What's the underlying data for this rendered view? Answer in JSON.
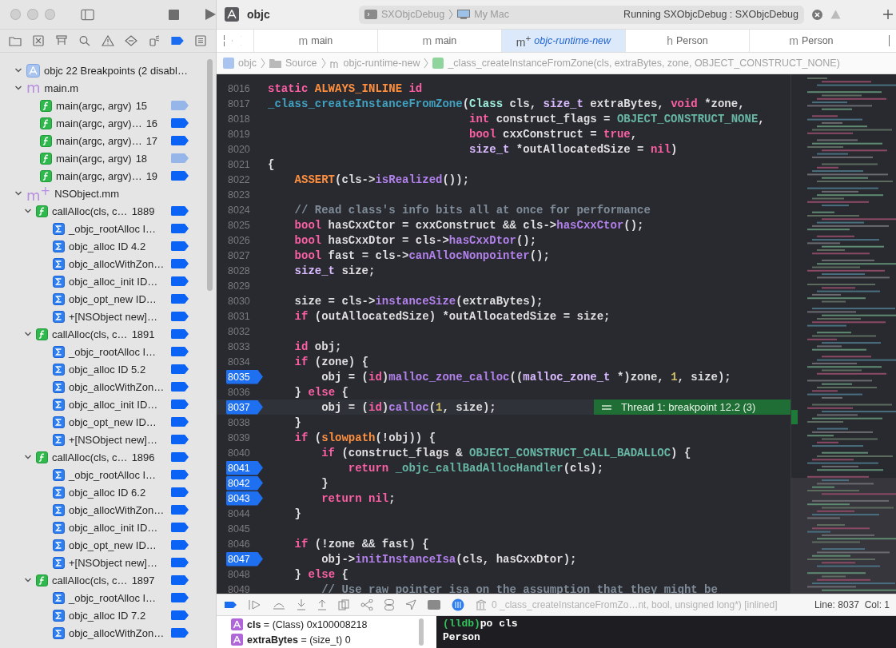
{
  "toolbar": {
    "project": "objc",
    "scheme": "SXObjcDebug",
    "destination": "My Mac",
    "status": "Running SXObjcDebug : SXObjcDebug"
  },
  "navigator": {
    "icons": [
      {
        "kind": "folder",
        "selected": false
      },
      {
        "kind": "xbox",
        "selected": false
      },
      {
        "kind": "hierarchy",
        "selected": false
      },
      {
        "kind": "search",
        "selected": false
      },
      {
        "kind": "warning",
        "selected": false
      },
      {
        "kind": "diamond",
        "selected": false
      },
      {
        "kind": "spray",
        "selected": false
      },
      {
        "kind": "breakpoint",
        "selected": true
      },
      {
        "kind": "report",
        "selected": false
      }
    ]
  },
  "breakpoints": {
    "root": {
      "label": "objc 22 Breakpoints (2 disabl…",
      "expanded": true
    },
    "files": [
      {
        "name": "main.m",
        "letter": "m",
        "expanded": true,
        "items": [
          {
            "kind": "function",
            "label": "main(argc, argv)",
            "line": "15",
            "enabled": false
          },
          {
            "kind": "function",
            "label": "main(argc, argv)…",
            "line": "16",
            "enabled": true
          },
          {
            "kind": "function",
            "label": "main(argc, argv)…",
            "line": "17",
            "enabled": true
          },
          {
            "kind": "function",
            "label": "main(argc, argv)",
            "line": "18",
            "enabled": false
          },
          {
            "kind": "function",
            "label": "main(argc, argv)…",
            "line": "19",
            "enabled": true
          }
        ]
      },
      {
        "name": "NSObject.mm",
        "letter": "m$^{+}$",
        "expanded": true,
        "items": [
          {
            "kind": "function",
            "label": "callAlloc(cls, c…",
            "line": "1889",
            "enabled": true,
            "expanded": true,
            "children": [
              {
                "kind": "symbol",
                "label": "_objc_rootAlloc  I…",
                "enabled": true
              },
              {
                "kind": "symbol",
                "label": "objc_alloc  ID 4.2",
                "enabled": true
              },
              {
                "kind": "symbol",
                "label": "objc_allocWithZon…",
                "enabled": true
              },
              {
                "kind": "symbol",
                "label": "objc_alloc_init  ID…",
                "enabled": true
              },
              {
                "kind": "symbol",
                "label": "objc_opt_new  ID…",
                "enabled": true
              },
              {
                "kind": "symbol",
                "label": "+[NSObject new]…",
                "enabled": true
              }
            ]
          },
          {
            "kind": "function",
            "label": "callAlloc(cls, c…",
            "line": "1891",
            "enabled": true,
            "expanded": true,
            "children": [
              {
                "kind": "symbol",
                "label": "_objc_rootAlloc  I…",
                "enabled": true
              },
              {
                "kind": "symbol",
                "label": "objc_alloc  ID 5.2",
                "enabled": true
              },
              {
                "kind": "symbol",
                "label": "objc_allocWithZon…",
                "enabled": true
              },
              {
                "kind": "symbol",
                "label": "objc_alloc_init  ID…",
                "enabled": true
              },
              {
                "kind": "symbol",
                "label": "objc_opt_new  ID…",
                "enabled": true
              },
              {
                "kind": "symbol",
                "label": "+[NSObject new]…",
                "enabled": true
              }
            ]
          },
          {
            "kind": "function",
            "label": "callAlloc(cls, c…",
            "line": "1896",
            "enabled": true,
            "expanded": true,
            "children": [
              {
                "kind": "symbol",
                "label": "_objc_rootAlloc  I…",
                "enabled": true
              },
              {
                "kind": "symbol",
                "label": "objc_alloc  ID 6.2",
                "enabled": true
              },
              {
                "kind": "symbol",
                "label": "objc_allocWithZon…",
                "enabled": true
              },
              {
                "kind": "symbol",
                "label": "objc_alloc_init  ID…",
                "enabled": true
              },
              {
                "kind": "symbol",
                "label": "objc_opt_new  ID…",
                "enabled": true
              },
              {
                "kind": "symbol",
                "label": "+[NSObject new]…",
                "enabled": true
              }
            ]
          },
          {
            "kind": "function",
            "label": "callAlloc(cls, c…",
            "line": "1897",
            "enabled": true,
            "expanded": true,
            "children": [
              {
                "kind": "symbol",
                "label": "_objc_rootAlloc  I…",
                "enabled": true
              },
              {
                "kind": "symbol",
                "label": "objc_alloc  ID 7.2",
                "enabled": true
              },
              {
                "kind": "symbol",
                "label": "objc_allocWithZon…",
                "enabled": true
              }
            ]
          }
        ]
      }
    ]
  },
  "tabs": [
    {
      "letter": "m",
      "label": "main",
      "selected": false
    },
    {
      "letter": "m",
      "label": "main",
      "selected": false
    },
    {
      "letter": "m$^{+}$",
      "label": "objc-runtime-new",
      "selected": true
    },
    {
      "letter": "h",
      "label": "Person",
      "selected": false
    },
    {
      "letter": "m",
      "label": "Person",
      "selected": false
    }
  ],
  "jump_bar": [
    "objc",
    "Source",
    "objc-runtime-new",
    "_class_createInstanceFromZone(cls, extraBytes, zone, OBJECT_CONSTRUCT_NONE)"
  ],
  "code": {
    "annotation": "Thread 1: breakpoint 12.2 (3)",
    "lines": [
      {
        "number": "8016",
        "breakpoint": false,
        "current": false,
        "tokens": [
          {
            "kind": "k",
            "text": "static "
          },
          {
            "kind": "m",
            "text": "ALWAYS_INLINE "
          },
          {
            "kind": "k",
            "text": "id"
          }
        ]
      },
      {
        "number": "8017",
        "breakpoint": false,
        "current": false,
        "tokens": [
          {
            "kind": "d",
            "text": "_class_createInstanceFromZone"
          },
          {
            "kind": "x",
            "text": "("
          },
          {
            "kind": "c",
            "text": "Class"
          },
          {
            "kind": "x",
            "text": " cls, "
          },
          {
            "kind": "t",
            "text": "size_t"
          },
          {
            "kind": "x",
            "text": " extraBytes, "
          },
          {
            "kind": "k",
            "text": "void"
          },
          {
            "kind": "x",
            "text": " *zone,"
          }
        ]
      },
      {
        "number": "8018",
        "breakpoint": false,
        "current": false,
        "tokens": [
          {
            "kind": "k",
            "text": "                              int"
          },
          {
            "kind": "x",
            "text": " construct_flags = "
          },
          {
            "kind": "p",
            "text": "OBJECT_CONSTRUCT_NONE"
          },
          {
            "kind": "x",
            "text": ","
          }
        ]
      },
      {
        "number": "8019",
        "breakpoint": false,
        "current": false,
        "tokens": [
          {
            "kind": "k",
            "text": "                              bool"
          },
          {
            "kind": "x",
            "text": " cxxConstruct = "
          },
          {
            "kind": "k",
            "text": "true"
          },
          {
            "kind": "x",
            "text": ","
          }
        ]
      },
      {
        "number": "8020",
        "breakpoint": false,
        "current": false,
        "tokens": [
          {
            "kind": "t",
            "text": "                              size_t"
          },
          {
            "kind": "x",
            "text": " *outAllocatedSize = "
          },
          {
            "kind": "k",
            "text": "nil"
          },
          {
            "kind": "x",
            "text": ")"
          }
        ]
      },
      {
        "number": "8021",
        "breakpoint": false,
        "current": false,
        "tokens": [
          {
            "kind": "x",
            "text": "{"
          }
        ]
      },
      {
        "number": "8022",
        "breakpoint": false,
        "current": false,
        "tokens": [
          {
            "kind": "m",
            "text": "    ASSERT"
          },
          {
            "kind": "x",
            "text": "(cls->"
          },
          {
            "kind": "f",
            "text": "isRealized"
          },
          {
            "kind": "x",
            "text": "());"
          }
        ]
      },
      {
        "number": "8023",
        "breakpoint": false,
        "current": false
      },
      {
        "number": "8024",
        "breakpoint": false,
        "current": false,
        "tokens": [
          {
            "kind": "cm",
            "text": "    // Read class's info bits all at once for performance"
          }
        ]
      },
      {
        "number": "8025",
        "breakpoint": false,
        "current": false,
        "tokens": [
          {
            "kind": "k",
            "text": "    bool"
          },
          {
            "kind": "x",
            "text": " hasCxxCtor = cxxConstruct && cls->"
          },
          {
            "kind": "f",
            "text": "hasCxxCtor"
          },
          {
            "kind": "x",
            "text": "();"
          }
        ]
      },
      {
        "number": "8026",
        "breakpoint": false,
        "current": false,
        "tokens": [
          {
            "kind": "k",
            "text": "    bool"
          },
          {
            "kind": "x",
            "text": " hasCxxDtor = cls->"
          },
          {
            "kind": "f",
            "text": "hasCxxDtor"
          },
          {
            "kind": "x",
            "text": "();"
          }
        ]
      },
      {
        "number": "8027",
        "breakpoint": false,
        "current": false,
        "tokens": [
          {
            "kind": "k",
            "text": "    bool"
          },
          {
            "kind": "x",
            "text": " fast = cls->"
          },
          {
            "kind": "f",
            "text": "canAllocNonpointer"
          },
          {
            "kind": "x",
            "text": "();"
          }
        ]
      },
      {
        "number": "8028",
        "breakpoint": false,
        "current": false,
        "tokens": [
          {
            "kind": "t",
            "text": "    size_t"
          },
          {
            "kind": "x",
            "text": " size;"
          }
        ]
      },
      {
        "number": "8029",
        "breakpoint": false,
        "current": false
      },
      {
        "number": "8030",
        "breakpoint": false,
        "current": false,
        "tokens": [
          {
            "kind": "x",
            "text": "    size = cls->"
          },
          {
            "kind": "f",
            "text": "instanceSize"
          },
          {
            "kind": "x",
            "text": "(extraBytes);"
          }
        ]
      },
      {
        "number": "8031",
        "breakpoint": false,
        "current": false,
        "tokens": [
          {
            "kind": "k",
            "text": "    if"
          },
          {
            "kind": "x",
            "text": " (outAllocatedSize) *outAllocatedSize = size;"
          }
        ]
      },
      {
        "number": "8032",
        "breakpoint": false,
        "current": false
      },
      {
        "number": "8033",
        "breakpoint": false,
        "current": false,
        "tokens": [
          {
            "kind": "k",
            "text": "    id"
          },
          {
            "kind": "x",
            "text": " obj;"
          }
        ]
      },
      {
        "number": "8034",
        "breakpoint": false,
        "current": false,
        "tokens": [
          {
            "kind": "k",
            "text": "    if"
          },
          {
            "kind": "x",
            "text": " (zone) {"
          }
        ]
      },
      {
        "number": "8035",
        "breakpoint": true,
        "current": false,
        "tokens": [
          {
            "kind": "x",
            "text": "        obj = ("
          },
          {
            "kind": "k",
            "text": "id"
          },
          {
            "kind": "x",
            "text": ")"
          },
          {
            "kind": "f",
            "text": "malloc_zone_calloc"
          },
          {
            "kind": "x",
            "text": "(("
          },
          {
            "kind": "t",
            "text": "malloc_zone_t"
          },
          {
            "kind": "x",
            "text": " *)zone, "
          },
          {
            "kind": "n",
            "text": "1"
          },
          {
            "kind": "x",
            "text": ", size);"
          }
        ]
      },
      {
        "number": "8036",
        "breakpoint": false,
        "current": false,
        "tokens": [
          {
            "kind": "x",
            "text": "    } "
          },
          {
            "kind": "k",
            "text": "else"
          },
          {
            "kind": "x",
            "text": " {"
          }
        ]
      },
      {
        "number": "8037",
        "breakpoint": true,
        "current": true,
        "tokens": [
          {
            "kind": "x",
            "text": "        obj = ("
          },
          {
            "kind": "k",
            "text": "id"
          },
          {
            "kind": "x",
            "text": ")"
          },
          {
            "kind": "f",
            "text": "calloc"
          },
          {
            "kind": "x",
            "text": "("
          },
          {
            "kind": "n",
            "text": "1"
          },
          {
            "kind": "x",
            "text": ", size);"
          }
        ]
      },
      {
        "number": "8038",
        "breakpoint": false,
        "current": false,
        "tokens": [
          {
            "kind": "x",
            "text": "    }"
          }
        ]
      },
      {
        "number": "8039",
        "breakpoint": false,
        "current": false,
        "tokens": [
          {
            "kind": "k",
            "text": "    if"
          },
          {
            "kind": "x",
            "text": " ("
          },
          {
            "kind": "m",
            "text": "slowpath"
          },
          {
            "kind": "x",
            "text": "(!obj)) {"
          }
        ]
      },
      {
        "number": "8040",
        "breakpoint": false,
        "current": false,
        "tokens": [
          {
            "kind": "k",
            "text": "        if"
          },
          {
            "kind": "x",
            "text": " (construct_flags & "
          },
          {
            "kind": "p",
            "text": "OBJECT_CONSTRUCT_CALL_BADALLOC"
          },
          {
            "kind": "x",
            "text": ") {"
          }
        ]
      },
      {
        "number": "8041",
        "breakpoint": true,
        "current": false,
        "tokens": [
          {
            "kind": "k",
            "text": "            return "
          },
          {
            "kind": "p",
            "text": "_objc_callBadAllocHandler"
          },
          {
            "kind": "x",
            "text": "(cls);"
          }
        ]
      },
      {
        "number": "8042",
        "breakpoint": true,
        "current": false,
        "tokens": [
          {
            "kind": "x",
            "text": "        }"
          }
        ]
      },
      {
        "number": "8043",
        "breakpoint": true,
        "current": false,
        "tokens": [
          {
            "kind": "k",
            "text": "        return nil"
          },
          {
            "kind": "x",
            "text": ";"
          }
        ]
      },
      {
        "number": "8044",
        "breakpoint": false,
        "current": false,
        "tokens": [
          {
            "kind": "x",
            "text": "    }"
          }
        ]
      },
      {
        "number": "8045",
        "breakpoint": false,
        "current": false
      },
      {
        "number": "8046",
        "breakpoint": false,
        "current": false,
        "tokens": [
          {
            "kind": "k",
            "text": "    if"
          },
          {
            "kind": "x",
            "text": " (!zone && fast) {"
          }
        ]
      },
      {
        "number": "8047",
        "breakpoint": true,
        "current": false,
        "tokens": [
          {
            "kind": "x",
            "text": "        obj->"
          },
          {
            "kind": "f",
            "text": "initInstanceIsa"
          },
          {
            "kind": "x",
            "text": "(cls, hasCxxDtor);"
          }
        ]
      },
      {
        "number": "8048",
        "breakpoint": false,
        "current": false,
        "tokens": [
          {
            "kind": "x",
            "text": "    } "
          },
          {
            "kind": "k",
            "text": "else"
          },
          {
            "kind": "x",
            "text": " {"
          }
        ]
      },
      {
        "number": "8049",
        "breakpoint": false,
        "current": false,
        "tokens": [
          {
            "kind": "cm",
            "text": "        // Use raw pointer isa on the assumption that they might be"
          }
        ]
      }
    ]
  },
  "debug_bar": {
    "frame": "0 _class_createInstanceFromZo…nt, bool, unsigned long*) [inlined]",
    "position": "Line: 8037  Col: 1"
  },
  "variables": [
    {
      "name": "cls",
      "type": "= (Class)",
      "value": "0x100008218"
    },
    {
      "name": "extraBytes",
      "type": "= (size_t)",
      "value": "0"
    }
  ],
  "console": [
    {
      "prompt": "(lldb)",
      "text": "po cls"
    },
    {
      "text": "Person"
    }
  ]
}
